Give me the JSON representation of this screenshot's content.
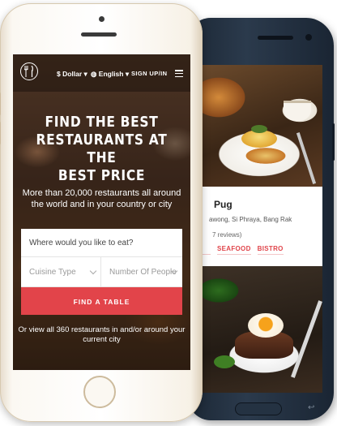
{
  "back_phone": {
    "restaurant": {
      "name": "Pug",
      "address": "awong, Si Phraya, Bang Rak",
      "reviews": "7 reviews)",
      "tags": [
        "",
        "SEAFOOD",
        "BISTRO"
      ]
    },
    "back_key_glyph": "↩"
  },
  "front_phone": {
    "topbar": {
      "currency": "$ Dollar ▾",
      "language": "◍ English ▾",
      "signup": "SIGN UP/IN"
    },
    "hero": {
      "title_line1": "FIND THE BEST",
      "title_line2": "RESTAURANTS AT THE",
      "title_line3": "BEST PRICE",
      "subtitle": "More than 20,000 restaurants all around the world and in your country or city"
    },
    "search": {
      "where_placeholder": "Where would you like to eat?",
      "cuisine_label": "Cuisine Type",
      "people_label": "Number Of People",
      "find_button": "FIND A TABLE"
    },
    "view_all": "Or view all 360 restaurants in and/or around your current city"
  },
  "colors": {
    "accent": "#e2444a",
    "phone_dark": "#1c2836",
    "phone_gold": "#cdbb9d"
  },
  "icons": [
    "logo-cutlery-icon",
    "menu-icon",
    "chevron-down-icon",
    "globe-icon",
    "home-button-icon"
  ]
}
